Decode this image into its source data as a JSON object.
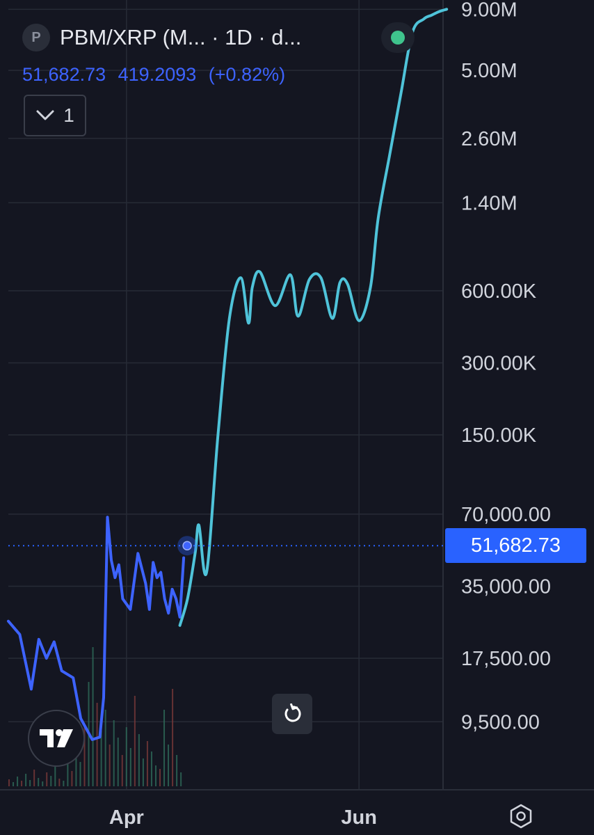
{
  "header": {
    "symbol_badge": "P",
    "title": "PBM/XRP (M... · 1D · d...",
    "status_color": "#3fc48d"
  },
  "quote": {
    "last": "51,682.73",
    "change": "419.2093",
    "change_pct": "(+0.82%)",
    "color": "#3d63ff"
  },
  "indicators_toggle": {
    "icon": "chevron-down-icon",
    "count": "1"
  },
  "price_tag": {
    "label": "51,682.73",
    "color": "#2962ff"
  },
  "icons": {
    "logo": "tradingview-logo",
    "reset": "reset-icon",
    "settings": "settings-icon"
  },
  "chart_data": {
    "type": "line",
    "y_scale": "log",
    "y_ticks": [
      {
        "label": "9.00M",
        "value": 9000000
      },
      {
        "label": "5.00M",
        "value": 5000000
      },
      {
        "label": "2.60M",
        "value": 2600000
      },
      {
        "label": "1.40M",
        "value": 1400000
      },
      {
        "label": "600.00K",
        "value": 600000
      },
      {
        "label": "300.00K",
        "value": 300000
      },
      {
        "label": "150.00K",
        "value": 150000
      },
      {
        "label": "70,000.00",
        "value": 70000
      },
      {
        "label": "35,000.00",
        "value": 35000
      },
      {
        "label": "17,500.00",
        "value": 17500
      },
      {
        "label": "9,500.00",
        "value": 9500
      }
    ],
    "x_ticks": [
      {
        "label": "Apr",
        "day": 31
      },
      {
        "label": "Jun",
        "day": 92
      }
    ],
    "last_price": 51682.73,
    "grid": true,
    "series": [
      {
        "color": "#3d63ff",
        "x": [
          0,
          3,
          6,
          8,
          10,
          12,
          14,
          17,
          19,
          22,
          24,
          25,
          26,
          27,
          28,
          29,
          30,
          32,
          34,
          36,
          37,
          38,
          39,
          40,
          41,
          42,
          43,
          44,
          45,
          46
        ],
        "y": [
          25000,
          22000,
          13000,
          21000,
          17500,
          20500,
          15500,
          14500,
          9800,
          8000,
          8200,
          12000,
          68000,
          45000,
          38000,
          43000,
          31000,
          28000,
          48000,
          36000,
          28000,
          44000,
          38000,
          40000,
          31000,
          27000,
          34000,
          31000,
          26000,
          46000
        ]
      },
      {
        "color": "#4fc3d9",
        "x": [
          45,
          47,
          49,
          50,
          52,
          55,
          58,
          61,
          63,
          64,
          66,
          70,
          74,
          76,
          79,
          82,
          85,
          87,
          89,
          92,
          95,
          97,
          100,
          103,
          106,
          109,
          111,
          113,
          115
        ],
        "y": [
          24000,
          31000,
          48000,
          63000,
          40000,
          150000,
          460000,
          680000,
          440000,
          620000,
          720000,
          520000,
          700000,
          470000,
          670000,
          680000,
          460000,
          650000,
          640000,
          450000,
          620000,
          1200000,
          2200000,
          4000000,
          7200000,
          8200000,
          8500000,
          8800000,
          9000000
        ]
      }
    ]
  }
}
